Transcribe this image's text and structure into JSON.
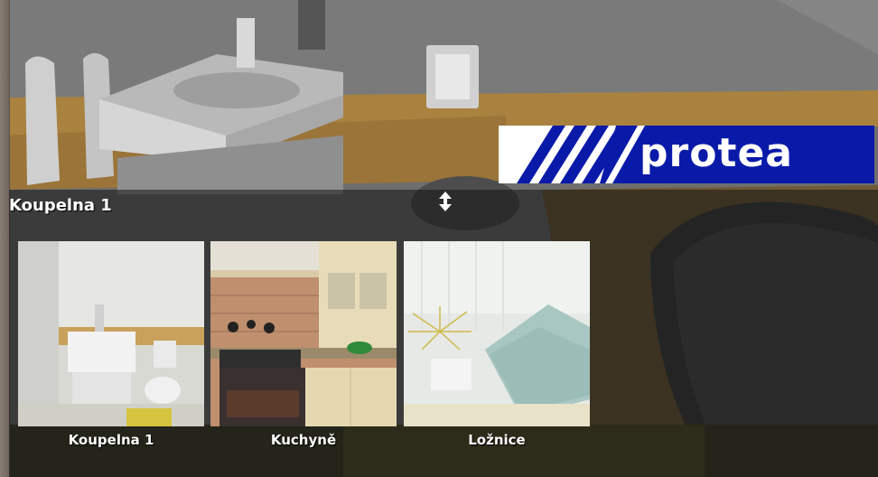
{
  "logo": {
    "text": "protea",
    "colors": {
      "brand_blue": "#0a1aa8",
      "white": "#ffffff"
    }
  },
  "gallery": {
    "title": "Koupelna 1",
    "resize_icon": "vertical-resize-arrows-icon",
    "items": [
      {
        "label": "Koupelna 1"
      },
      {
        "label": "Kuchyně"
      },
      {
        "label": "Ložnice"
      }
    ]
  }
}
